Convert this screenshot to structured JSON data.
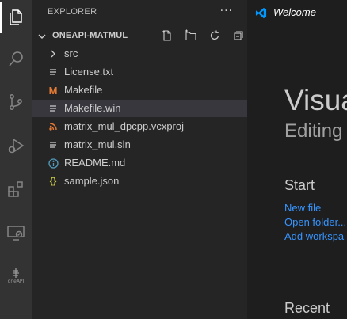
{
  "activity_bar": {
    "items": [
      {
        "name": "explorer",
        "icon": "files-icon",
        "active": true
      },
      {
        "name": "search",
        "icon": "search-icon"
      },
      {
        "name": "source-control",
        "icon": "source-control-icon"
      },
      {
        "name": "run-debug",
        "icon": "debug-icon"
      },
      {
        "name": "extensions",
        "icon": "extensions-icon"
      },
      {
        "name": "remote-explorer",
        "icon": "remote-explorer-icon"
      },
      {
        "name": "oneapi",
        "icon": "oneapi-icon",
        "label": "oneAPI"
      }
    ]
  },
  "sidebar": {
    "title": "EXPLORER",
    "more": "···",
    "section": {
      "title": "ONEAPI-MATMUL",
      "actions": [
        "new-file-icon",
        "new-folder-icon",
        "refresh-icon",
        "collapse-all-icon"
      ]
    },
    "items": [
      {
        "label": "src",
        "icon": "chevron-right-icon",
        "type": "folder"
      },
      {
        "label": "License.txt",
        "icon": "text-file-icon"
      },
      {
        "label": "Makefile",
        "icon": "makefile-icon",
        "glyph": "M"
      },
      {
        "label": "Makefile.win",
        "icon": "text-file-icon",
        "selected": true
      },
      {
        "label": "matrix_mul_dpcpp.vcxproj",
        "icon": "rss-icon"
      },
      {
        "label": "matrix_mul.sln",
        "icon": "text-file-icon"
      },
      {
        "label": "README.md",
        "icon": "info-icon"
      },
      {
        "label": "sample.json",
        "icon": "json-icon",
        "glyph": "{}"
      }
    ]
  },
  "editor": {
    "tab": {
      "label": "Welcome",
      "icon": "vscode-logo-icon"
    },
    "welcome": {
      "title": "Visua",
      "subtitle": "Editing",
      "start_heading": "Start",
      "links": [
        "New file",
        "Open folder...",
        "Add workspa"
      ],
      "recent_heading": "Recent"
    }
  },
  "colors": {
    "activity_bar": "#333333",
    "sidebar": "#252526",
    "editor": "#1e1e1e",
    "link": "#3794ff",
    "makefile_icon": "#e37933",
    "rss_icon": "#e37933",
    "info_icon": "#519aba",
    "json_icon": "#cbcb41",
    "vscode_blue": "#0098ff"
  }
}
